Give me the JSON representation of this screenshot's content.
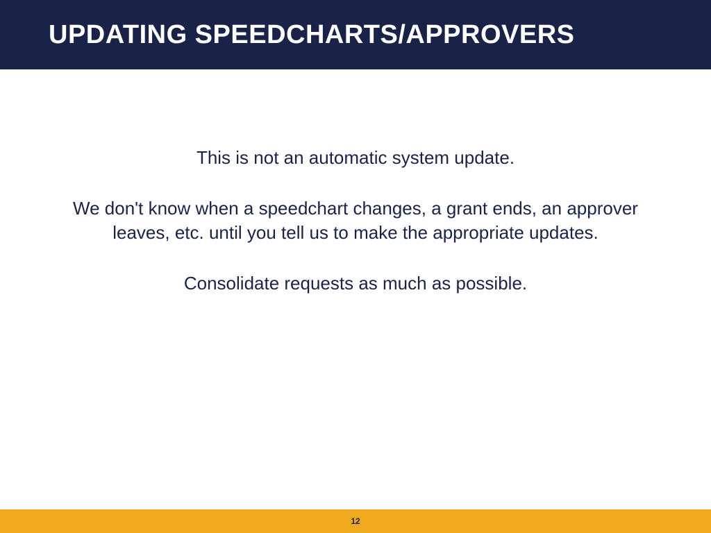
{
  "header": {
    "title": "UPDATING SPEEDCHARTS/APPROVERS"
  },
  "body": {
    "paragraphs": [
      "This is not an automatic system update.",
      "We don't know when a speedchart changes, a grant ends, an approver leaves, etc. until you tell us to make the appropriate updates.",
      "Consolidate requests as much as possible."
    ]
  },
  "footer": {
    "page_number": "12"
  }
}
